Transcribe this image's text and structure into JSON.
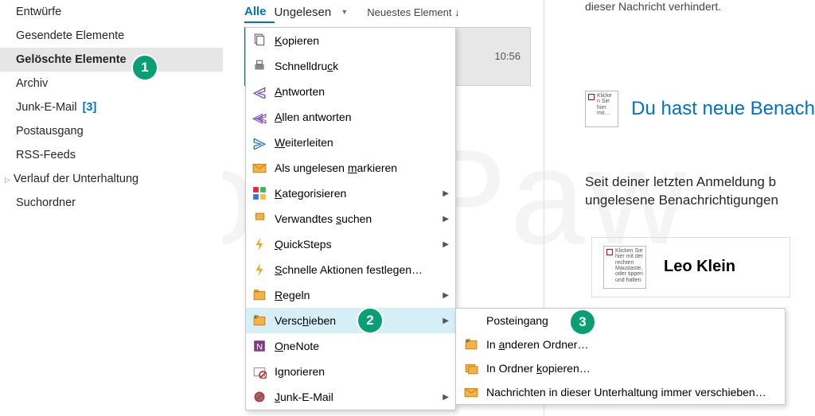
{
  "folders": {
    "items": [
      {
        "label": "Entwürfe",
        "selected": false
      },
      {
        "label": "Gesendete Elemente",
        "selected": false
      },
      {
        "label": "Gelöschte Elemente",
        "selected": true
      },
      {
        "label": "Archiv",
        "selected": false
      },
      {
        "label": "Junk-E-Mail",
        "selected": false,
        "count": "[3]"
      },
      {
        "label": "Postausgang",
        "selected": false
      },
      {
        "label": "RSS-Feeds",
        "selected": false
      },
      {
        "label": "Verlauf der Unterhaltung",
        "selected": false,
        "expander": true
      },
      {
        "label": "Suchordner",
        "selected": false
      }
    ]
  },
  "list": {
    "tab_all": "Alle",
    "tab_unread": "Ungelesen",
    "sort": "Neuestes Element  ↓",
    "time": "10:56"
  },
  "reading": {
    "infobar": "dieser Nachricht verhindert.",
    "placeholder_small": "Klicke n Sie hier mit…",
    "title": "Du hast neue Benach",
    "body1": "Seit deiner letzten Anmeldung b",
    "body2": "ungelesene Benachrichtigungen",
    "card_ph": "Klicken Sie hier mit der rechten Maustaste, oder tippen und halten",
    "card_name": "Leo Klein"
  },
  "ctx": {
    "items": [
      {
        "label": "Kopieren",
        "accel": 0,
        "icon": "copy"
      },
      {
        "label": "Schnelldruck",
        "accel": 10,
        "icon": "print"
      },
      {
        "label": "Antworten",
        "accel": 0,
        "icon": "reply"
      },
      {
        "label": "Allen antworten",
        "accel": 0,
        "icon": "reply-all"
      },
      {
        "label": "Weiterleiten",
        "accel": 0,
        "icon": "forward"
      },
      {
        "label": "Als ungelesen markieren",
        "accel": 14,
        "icon": "mail"
      },
      {
        "label": "Kategorisieren",
        "accel": 0,
        "icon": "categories",
        "sub": true
      },
      {
        "label": "Verwandtes suchen",
        "accel": 11,
        "icon": "search",
        "sub": true
      },
      {
        "label": "QuickSteps",
        "accel": 0,
        "icon": "quick",
        "sub": true
      },
      {
        "label": "Schnelle Aktionen festlegen…",
        "accel": 0,
        "icon": "quick"
      },
      {
        "label": "Regeln",
        "accel": 0,
        "icon": "rules",
        "sub": true
      },
      {
        "label": "Verschieben",
        "accel": 5,
        "icon": "move",
        "sub": true,
        "hover": true
      },
      {
        "label": "OneNote",
        "accel": 0,
        "icon": "onenote"
      },
      {
        "label": "Ignorieren",
        "accel": 1,
        "icon": "ignore"
      },
      {
        "label": "Junk-E-Mail",
        "accel": 0,
        "icon": "junk",
        "sub": true
      }
    ]
  },
  "submenu": {
    "items": [
      {
        "label": "Posteingang",
        "icon": ""
      },
      {
        "label": "In anderen Ordner…",
        "accel": 3,
        "icon": "move"
      },
      {
        "label": "In Ordner kopieren…",
        "accel": 10,
        "icon": "copy-folder"
      },
      {
        "label": "Nachrichten in dieser Unterhaltung immer verschieben…",
        "accel": 53,
        "icon": "mail"
      }
    ]
  },
  "badges": {
    "1": "1",
    "2": "2",
    "3": "3"
  },
  "watermark": "FonePaw"
}
